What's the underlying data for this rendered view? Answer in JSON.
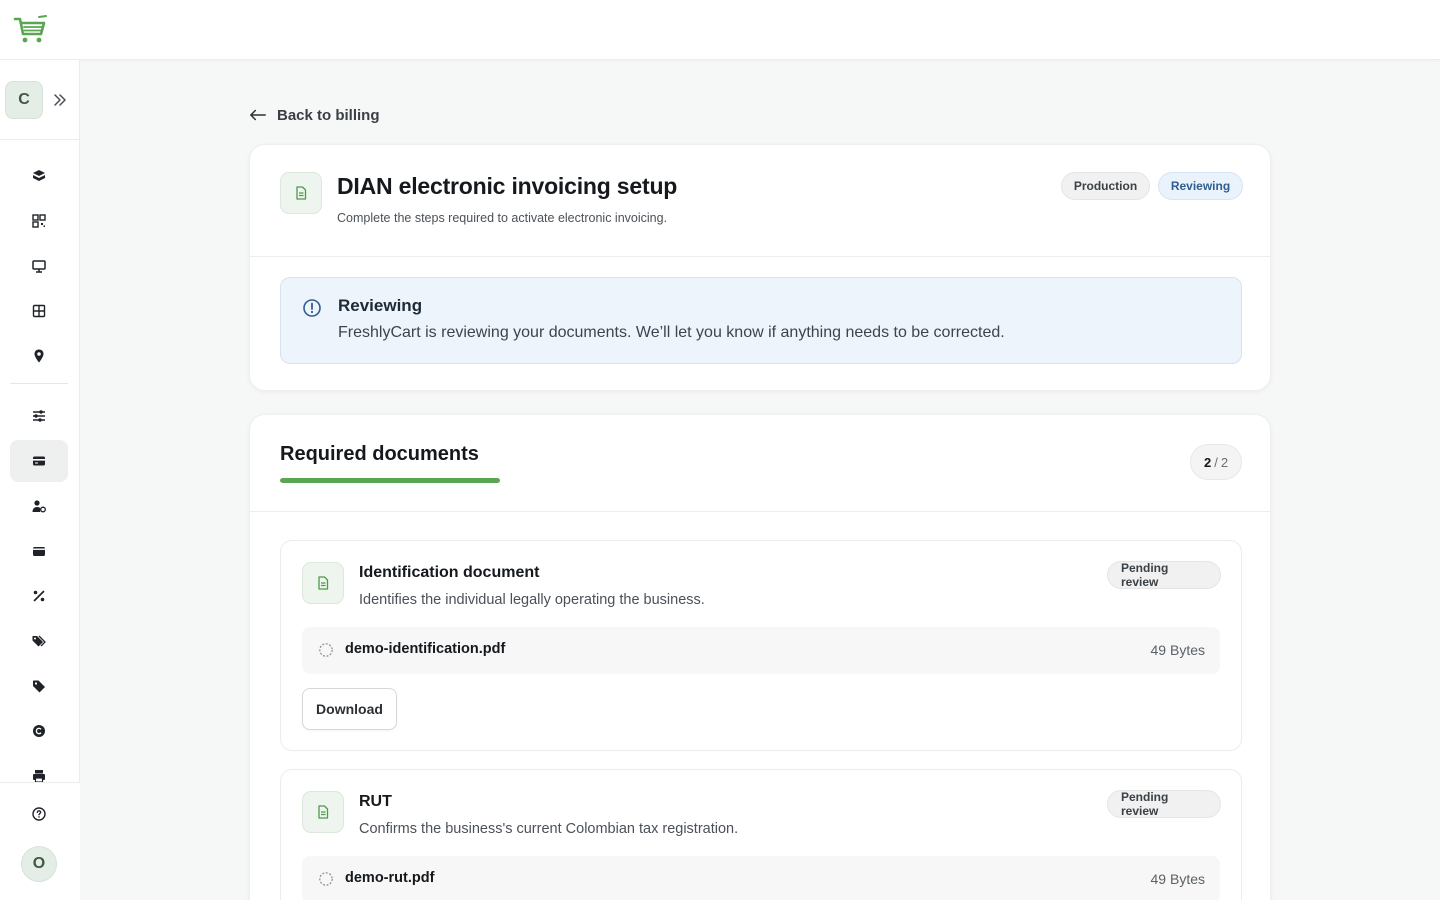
{
  "app": {
    "store_initial": "C",
    "user_initial": "O",
    "brand_color": "#5aa552"
  },
  "sidebar": {
    "items": [
      {
        "icon": "box-icon"
      },
      {
        "icon": "qr-code-icon"
      },
      {
        "icon": "monitor-icon"
      },
      {
        "icon": "grid-icon"
      },
      {
        "icon": "map-pin-icon"
      },
      {
        "icon": "sliders-icon"
      },
      {
        "icon": "credit-card-icon",
        "active": true
      },
      {
        "icon": "user-settings-icon"
      },
      {
        "icon": "wallet-icon"
      },
      {
        "icon": "percent-icon"
      },
      {
        "icon": "tags-icon"
      },
      {
        "icon": "tag-icon"
      },
      {
        "icon": "copyright-icon"
      },
      {
        "icon": "printer-icon"
      }
    ],
    "help_icon": "help-circle-icon"
  },
  "page": {
    "back_label": "Back to billing",
    "title": "DIAN electronic invoicing setup",
    "subtitle": "Complete the steps required to activate electronic invoicing.",
    "env_badge": "Production",
    "status_badge": "Reviewing"
  },
  "alert": {
    "title": "Reviewing",
    "text": "FreshlyCart is reviewing your documents. We’ll let you know if anything needs to be corrected."
  },
  "documents": {
    "title": "Required documents",
    "completed": "2",
    "separator": "/",
    "total": "2",
    "progress": 1.0,
    "items": [
      {
        "title": "Identification document",
        "description": "Identifies the individual legally operating the business.",
        "status": "Pending review",
        "file_name": "demo-identification.pdf",
        "file_size": "49 Bytes",
        "download_label": "Download"
      },
      {
        "title": "RUT",
        "description": "Confirms the business's current Colombian tax registration.",
        "status": "Pending review",
        "file_name": "demo-rut.pdf",
        "file_size": "49 Bytes"
      }
    ]
  }
}
